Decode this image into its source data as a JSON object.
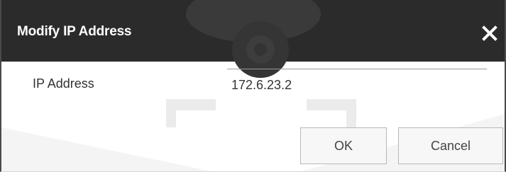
{
  "dialog": {
    "title": "Modify IP Address",
    "close_icon": "close-icon"
  },
  "form": {
    "ip_label": "IP Address",
    "ip_value": "172.6.23.2"
  },
  "buttons": {
    "ok_label": "OK",
    "cancel_label": "Cancel"
  },
  "colors": {
    "title_bar": "#2b2b2b",
    "title_text": "#ffffff",
    "body": "#ffffff",
    "button_bg": "#f7f7f7",
    "button_border": "#b8b8b8"
  }
}
